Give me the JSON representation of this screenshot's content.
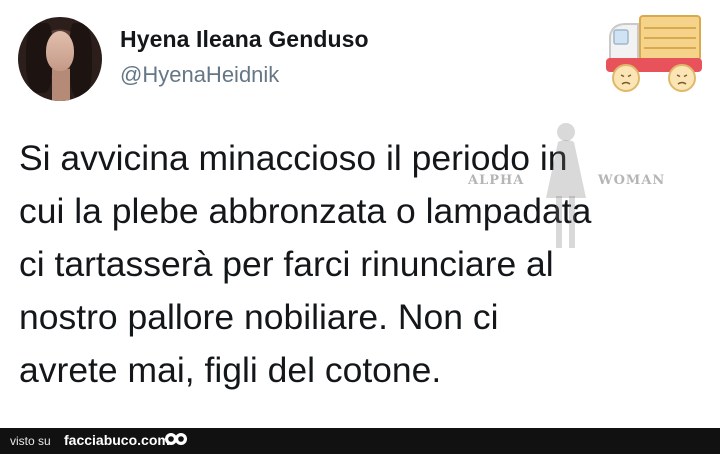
{
  "tweet": {
    "display_name": "Hyena Ileana Genduso",
    "handle": "@HyenaHeidnik",
    "avatar_icon": "user-avatar",
    "text_lines": [
      "Si avvicina minaccioso il periodo in",
      "cui la plebe abbronzata o lampadata",
      "ci tartasserà per farci rinunciare al",
      "nostro pallore nobiliare. Non ci",
      "avrete mai, figli del cotone."
    ],
    "text_color": "#14171a",
    "handle_color": "#657786"
  },
  "watermark": {
    "left": "ALPHA",
    "right": "WOMAN"
  },
  "sticker": {
    "icon": "sad-truck-icon"
  },
  "footer": {
    "prefix": "visto su",
    "site": "facciabuco.com",
    "icon": "eyes-icon",
    "background": "#111111"
  }
}
